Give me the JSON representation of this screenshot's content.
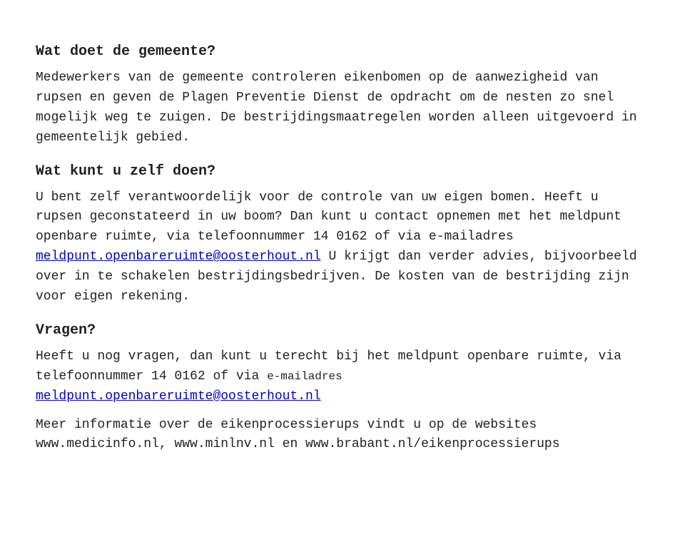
{
  "heading1": "Wat doet de gemeente?",
  "paragraph1": "Medewerkers van de gemeente controleren eikenbomen op de aanwezigheid van rupsen en geven de Plagen Preventie Dienst de opdracht om de nesten zo snel mogelijk weg te zuigen. De bestrijdingsmaatregelen worden alleen uitgevoerd in gemeentelijk gebied.",
  "heading2": "Wat kunt u zelf doen?",
  "paragraph2": "U bent zelf verantwoordelijk voor de controle van uw eigen bomen. Heeft u rupsen geconstateerd in uw boom? Dan kunt u contact opnemen met het meldpunt openbare ruimte, via telefoonnummer 14 0162 of via e-mailadres ",
  "link1": "meldpunt.openbareruimte@oosterhout.nl",
  "link1_href": "mailto:meldpunt.openbareruimte@oosterhout.nl",
  "paragraph2b": " U krijgt dan verder advies, bijvoorbeeld over in te schakelen bestrijdingsbedrijven. De kosten van de bestrijding zijn voor eigen rekening.",
  "heading3": "Vragen?",
  "paragraph3a": "Heeft u nog vragen, dan kunt u terecht bij het meldpunt openbare ruimte, via telefoonnummer 14 0162 of via ",
  "paragraph3b": "e-mailadres",
  "link2": "meldpunt.openbareruimte@oosterhout.nl",
  "link2_href": "mailto:meldpunt.openbareruimte@oosterhout.nl",
  "paragraph4": "Meer informatie over de eikenprocessierups vindt u op de websites www.medicinfo.nl, www.minlnv.nl en www.brabant.nl/eikenprocessierups"
}
